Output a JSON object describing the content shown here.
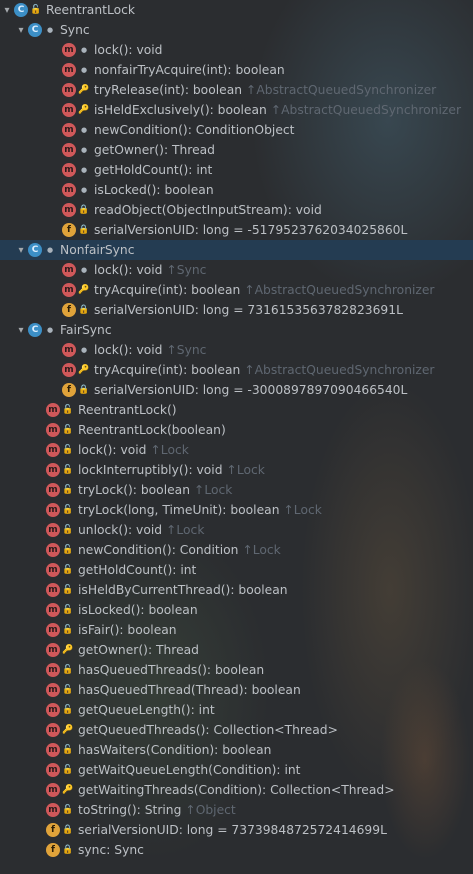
{
  "root": {
    "label": "ReentrantLock",
    "icon": "class-icon"
  },
  "sync": {
    "label": "Sync",
    "members": [
      {
        "icon": "method-icon",
        "vis": "package",
        "text": "lock(): void",
        "over": ""
      },
      {
        "icon": "method-icon",
        "vis": "package",
        "text": "nonfairTryAcquire(int): boolean",
        "over": ""
      },
      {
        "icon": "method-icon",
        "vis": "protected",
        "text": "tryRelease(int): boolean",
        "over": "↑AbstractQueuedSynchronizer"
      },
      {
        "icon": "method-icon",
        "vis": "protected",
        "text": "isHeldExclusively(): boolean",
        "over": "↑AbstractQueuedSynchronizer"
      },
      {
        "icon": "method-icon",
        "vis": "package",
        "text": "newCondition(): ConditionObject",
        "over": ""
      },
      {
        "icon": "method-icon",
        "vis": "package",
        "text": "getOwner(): Thread",
        "over": ""
      },
      {
        "icon": "method-icon",
        "vis": "package",
        "text": "getHoldCount(): int",
        "over": ""
      },
      {
        "icon": "method-icon",
        "vis": "package",
        "text": "isLocked(): boolean",
        "over": ""
      },
      {
        "icon": "method-icon",
        "vis": "private",
        "text": "readObject(ObjectInputStream): void",
        "over": ""
      },
      {
        "icon": "field-icon",
        "vis": "private",
        "text": "serialVersionUID: long = -5179523762034025860L",
        "over": ""
      }
    ]
  },
  "nonfair": {
    "label": "NonfairSync",
    "members": [
      {
        "icon": "method-icon",
        "vis": "package",
        "text": "lock(): void",
        "over": "↑Sync"
      },
      {
        "icon": "method-icon",
        "vis": "protected",
        "text": "tryAcquire(int): boolean",
        "over": "↑AbstractQueuedSynchronizer"
      },
      {
        "icon": "field-icon",
        "vis": "private",
        "text": "serialVersionUID: long = 7316153563782823691L",
        "over": ""
      }
    ]
  },
  "fair": {
    "label": "FairSync",
    "members": [
      {
        "icon": "method-icon",
        "vis": "package",
        "text": "lock(): void",
        "over": "↑Sync"
      },
      {
        "icon": "method-icon",
        "vis": "protected",
        "text": "tryAcquire(int): boolean",
        "over": "↑AbstractQueuedSynchronizer"
      },
      {
        "icon": "field-icon",
        "vis": "private",
        "text": "serialVersionUID: long = -3000897897090466540L",
        "over": ""
      }
    ]
  },
  "members": [
    {
      "icon": "method-icon",
      "vis": "public",
      "text": "ReentrantLock()",
      "over": ""
    },
    {
      "icon": "method-icon",
      "vis": "public",
      "text": "ReentrantLock(boolean)",
      "over": ""
    },
    {
      "icon": "method-icon",
      "vis": "public",
      "text": "lock(): void",
      "over": "↑Lock"
    },
    {
      "icon": "method-icon",
      "vis": "public",
      "text": "lockInterruptibly(): void",
      "over": "↑Lock"
    },
    {
      "icon": "method-icon",
      "vis": "public",
      "text": "tryLock(): boolean",
      "over": "↑Lock"
    },
    {
      "icon": "method-icon",
      "vis": "public",
      "text": "tryLock(long, TimeUnit): boolean",
      "over": "↑Lock"
    },
    {
      "icon": "method-icon",
      "vis": "public",
      "text": "unlock(): void",
      "over": "↑Lock"
    },
    {
      "icon": "method-icon",
      "vis": "public",
      "text": "newCondition(): Condition",
      "over": "↑Lock"
    },
    {
      "icon": "method-icon",
      "vis": "public",
      "text": "getHoldCount(): int",
      "over": ""
    },
    {
      "icon": "method-icon",
      "vis": "public",
      "text": "isHeldByCurrentThread(): boolean",
      "over": ""
    },
    {
      "icon": "method-icon",
      "vis": "public",
      "text": "isLocked(): boolean",
      "over": ""
    },
    {
      "icon": "method-icon",
      "vis": "public",
      "text": "isFair(): boolean",
      "over": ""
    },
    {
      "icon": "method-icon",
      "vis": "protected",
      "text": "getOwner(): Thread",
      "over": ""
    },
    {
      "icon": "method-icon",
      "vis": "public",
      "text": "hasQueuedThreads(): boolean",
      "over": ""
    },
    {
      "icon": "method-icon",
      "vis": "public",
      "text": "hasQueuedThread(Thread): boolean",
      "over": ""
    },
    {
      "icon": "method-icon",
      "vis": "public",
      "text": "getQueueLength(): int",
      "over": ""
    },
    {
      "icon": "method-icon",
      "vis": "protected",
      "text": "getQueuedThreads(): Collection<Thread>",
      "over": ""
    },
    {
      "icon": "method-icon",
      "vis": "public",
      "text": "hasWaiters(Condition): boolean",
      "over": ""
    },
    {
      "icon": "method-icon",
      "vis": "public",
      "text": "getWaitQueueLength(Condition): int",
      "over": ""
    },
    {
      "icon": "method-icon",
      "vis": "protected",
      "text": "getWaitingThreads(Condition): Collection<Thread>",
      "over": ""
    },
    {
      "icon": "method-icon",
      "vis": "public",
      "text": "toString(): String",
      "over": "↑Object"
    },
    {
      "icon": "field-icon",
      "vis": "private",
      "text": "serialVersionUID: long = 7373984872572414699L",
      "over": ""
    },
    {
      "icon": "field-icon",
      "vis": "private",
      "text": "sync: Sync",
      "over": ""
    }
  ],
  "colors": {
    "background": "#2b2d30",
    "selection": "#243c52",
    "method": "#d0585a",
    "field": "#e0a33a",
    "class": "#3c8fc6"
  }
}
